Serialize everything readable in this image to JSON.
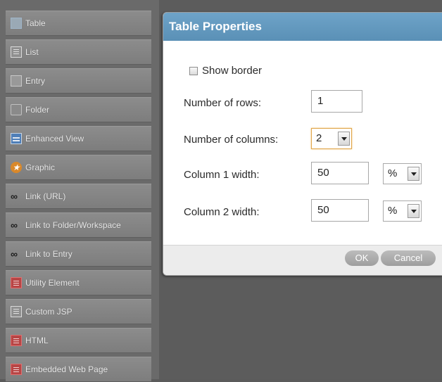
{
  "sidebar": {
    "items": [
      {
        "label": "Table",
        "icon": "table-icon"
      },
      {
        "label": "List",
        "icon": "list-icon"
      },
      {
        "label": "Entry",
        "icon": "entry-icon"
      },
      {
        "label": "Folder",
        "icon": "folder-icon"
      },
      {
        "label": "Enhanced View",
        "icon": "enhanced-view-icon"
      },
      {
        "label": "Graphic",
        "icon": "graphic-icon"
      },
      {
        "label": "Link (URL)",
        "icon": "link-icon"
      },
      {
        "label": "Link to Folder/Workspace",
        "icon": "link-folder-icon"
      },
      {
        "label": "Link to Entry",
        "icon": "link-entry-icon"
      },
      {
        "label": "Utility Element",
        "icon": "utility-icon"
      },
      {
        "label": "Custom JSP",
        "icon": "jsp-icon"
      },
      {
        "label": "HTML",
        "icon": "html-icon"
      },
      {
        "label": "Embedded Web Page",
        "icon": "web-page-icon"
      }
    ]
  },
  "dialog": {
    "title": "Table Properties",
    "show_border_label": "Show border",
    "rows_label": "Number of rows:",
    "rows_value": "1",
    "columns_label": "Number of columns:",
    "columns_value": "2",
    "col1_label": "Column 1 width:",
    "col1_value": "50",
    "col1_unit": "%",
    "col2_label": "Column 2 width:",
    "col2_value": "50",
    "col2_unit": "%",
    "ok_label": "OK",
    "cancel_label": "Cancel"
  },
  "colors": {
    "header": "#5f95ba",
    "sidebar_item": "#858585",
    "canvas": "#5c5c5c"
  }
}
